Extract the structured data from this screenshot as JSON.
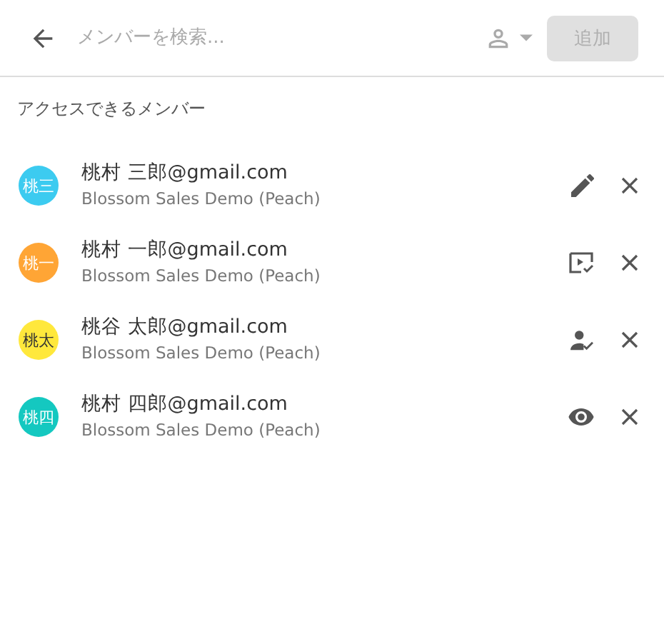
{
  "search": {
    "placeholder": "メンバーを検索..."
  },
  "add_button": {
    "label": "追加",
    "disabled": true
  },
  "section_title": "アクセスできるメンバー",
  "members": [
    {
      "avatar": "桃三",
      "color": "#3ccbf0",
      "name": "桃村 三郎@gmail.com",
      "org": "Blossom Sales Demo (Peach)",
      "kind": "edit"
    },
    {
      "avatar": "桃一",
      "color": "#ffa535",
      "name": "桃村 一郎@gmail.com",
      "org": "Blossom Sales Demo (Peach)",
      "kind": "present"
    },
    {
      "avatar": "桃太",
      "color": "#ffe83c",
      "name": "桃谷 太郎@gmail.com",
      "org": "Blossom Sales Demo (Peach)",
      "kind": "member"
    },
    {
      "avatar": "桃四",
      "color": "#14c8c0",
      "name": "桃村 四郎@gmail.com",
      "org": "Blossom Sales Demo (Peach)",
      "kind": "view"
    }
  ]
}
